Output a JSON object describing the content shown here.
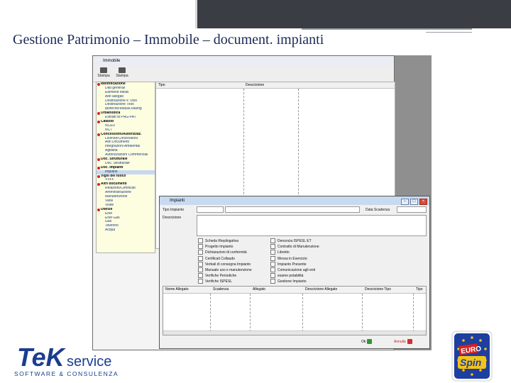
{
  "slide": {
    "title": "Gestione Patrimonio – Immobile – document. impianti",
    "colors": {
      "title": "#1a2a55",
      "topbar": "#3a3d43",
      "tek_blue": "#1b3d8f",
      "euro_blue": "#1e3fa0",
      "euro_red": "#d62020",
      "euro_yellow": "#f2c318"
    }
  },
  "app": {
    "title": "Immobile",
    "toolbar": [
      {
        "label": "Stampa",
        "icon": "printer-icon"
      },
      {
        "label": "Stampa",
        "icon": "printer-icon"
      }
    ],
    "tree": [
      {
        "label": "Identificazione",
        "type": "group"
      },
      {
        "label": "Dati generali",
        "type": "child"
      },
      {
        "label": "Elementi edilizi",
        "type": "child"
      },
      {
        "label": "Altri allegati",
        "type": "child"
      },
      {
        "label": "Destinazione e Titoli",
        "type": "child"
      },
      {
        "label": "Destinazione Titoli",
        "type": "child"
      },
      {
        "label": "Ipoteche/Mutui/Leasing",
        "type": "child"
      },
      {
        "label": "Urbanistica",
        "type": "group"
      },
      {
        "label": "Estratti di PRG-PAT",
        "type": "child"
      },
      {
        "label": "Catasto",
        "type": "group"
      },
      {
        "label": "NCEU",
        "type": "child"
      },
      {
        "label": "NCT",
        "type": "child"
      },
      {
        "label": "Concessioni/Autorizzaz.",
        "type": "group"
      },
      {
        "label": "Licenze/Concessioni",
        "type": "child"
      },
      {
        "label": "Altri Documenti",
        "type": "child"
      },
      {
        "label": "Integrazioni Ambiental",
        "type": "child"
      },
      {
        "label": "Agibilità",
        "type": "child"
      },
      {
        "label": "Autorizzazioni Commerciali",
        "type": "child"
      },
      {
        "label": "Doc. Strutturale",
        "type": "group"
      },
      {
        "label": "Doc. Strutturale",
        "type": "child"
      },
      {
        "label": "Doc. Impianti",
        "type": "group"
      },
      {
        "label": "Impianti",
        "type": "child",
        "selected": true
      },
      {
        "label": "Vigili del fuoco",
        "type": "group"
      },
      {
        "label": "VVFF",
        "type": "child"
      },
      {
        "label": "Altri documenti",
        "type": "group"
      },
      {
        "label": "Relazioni/Certificati",
        "type": "child"
      },
      {
        "label": "Amministrazione",
        "type": "child"
      },
      {
        "label": "Manutenzione",
        "type": "child"
      },
      {
        "label": "Varie",
        "type": "child"
      },
      {
        "label": "Visite",
        "type": "child"
      },
      {
        "label": "Utenze",
        "type": "group"
      },
      {
        "label": "Enel",
        "type": "child"
      },
      {
        "label": "Enel Gas",
        "type": "child"
      },
      {
        "label": "Gas",
        "type": "child"
      },
      {
        "label": "Telefono",
        "type": "child"
      },
      {
        "label": "Acqua",
        "type": "child"
      }
    ],
    "grid": {
      "columns": [
        "Tipo",
        "Descrizione"
      ]
    }
  },
  "dialog": {
    "title": "Impianti",
    "tipo_label": "Tipo Impianto",
    "data_scadenza_label": "Data Scadenza",
    "descrizione_label": "Descrizione",
    "checkboxes_left": [
      "Scheda Riepilogativa",
      "Progetto Impianto",
      "Dichiarazioni di conformità",
      "Certificati Collaudo",
      "Verbali di consegna Impianto",
      "Manuale uso e manutenzione",
      "Verifiche Periodiche",
      "Verifiche ISPESL"
    ],
    "checkboxes_right": [
      "Denuncia ISPESL ET",
      "Contratto di Manutenzione",
      "Libretto",
      "Messa in Esercizio",
      "Impianto Presente",
      "Comunicazione agli enti",
      "esame potabilità",
      "Gestione Impianto"
    ],
    "table_columns": [
      "Nome Allegato",
      "Scadenza",
      "Allegato",
      "Descrizione Allegato",
      "Descrizione Tipo",
      "Tipo"
    ],
    "ok_label": "Ok",
    "cancel_label": "Annulla"
  },
  "logos": {
    "tek_name": "TeK",
    "tek_suffix": "service",
    "tek_tagline": "SOFTWARE & CONSULENZA",
    "euro_top": "EURO",
    "euro_bottom": "Spin"
  }
}
